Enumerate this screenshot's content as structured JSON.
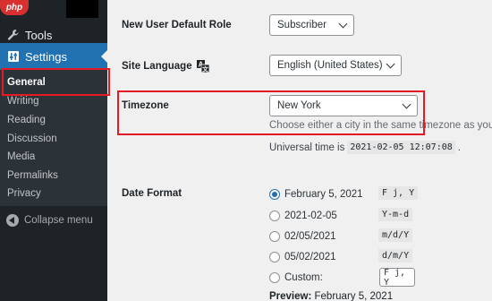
{
  "sidebar": {
    "tools_label": "Tools",
    "settings_label": "Settings",
    "items": [
      {
        "label": "General"
      },
      {
        "label": "Writing"
      },
      {
        "label": "Reading"
      },
      {
        "label": "Discussion"
      },
      {
        "label": "Media"
      },
      {
        "label": "Permalinks"
      },
      {
        "label": "Privacy"
      }
    ],
    "collapse_label": "Collapse menu"
  },
  "watermark": "php",
  "settings": {
    "default_role": {
      "label": "New User Default Role",
      "value": "Subscriber"
    },
    "site_language": {
      "label": "Site Language",
      "value": "English (United States)"
    },
    "timezone": {
      "label": "Timezone",
      "value": "New York",
      "description": "Choose either a city in the same timezone as you or",
      "utc_prefix": "Universal time is",
      "utc_value": "2021-02-05 12:07:08",
      "utc_suffix": "."
    },
    "date_format": {
      "label": "Date Format",
      "options": [
        {
          "label": "February 5, 2021",
          "format": "F j, Y",
          "checked": true
        },
        {
          "label": "2021-02-05",
          "format": "Y-m-d",
          "checked": false
        },
        {
          "label": "02/05/2021",
          "format": "m/d/Y",
          "checked": false
        },
        {
          "label": "05/02/2021",
          "format": "d/m/Y",
          "checked": false
        }
      ],
      "custom_label": "Custom:",
      "custom_value": "F j, Y",
      "preview_label": "Preview:",
      "preview_value": "February 5, 2021"
    }
  },
  "colors": {
    "accent": "#2271b1",
    "sidebar": "#1d2327",
    "highlight": "#e41b23"
  }
}
